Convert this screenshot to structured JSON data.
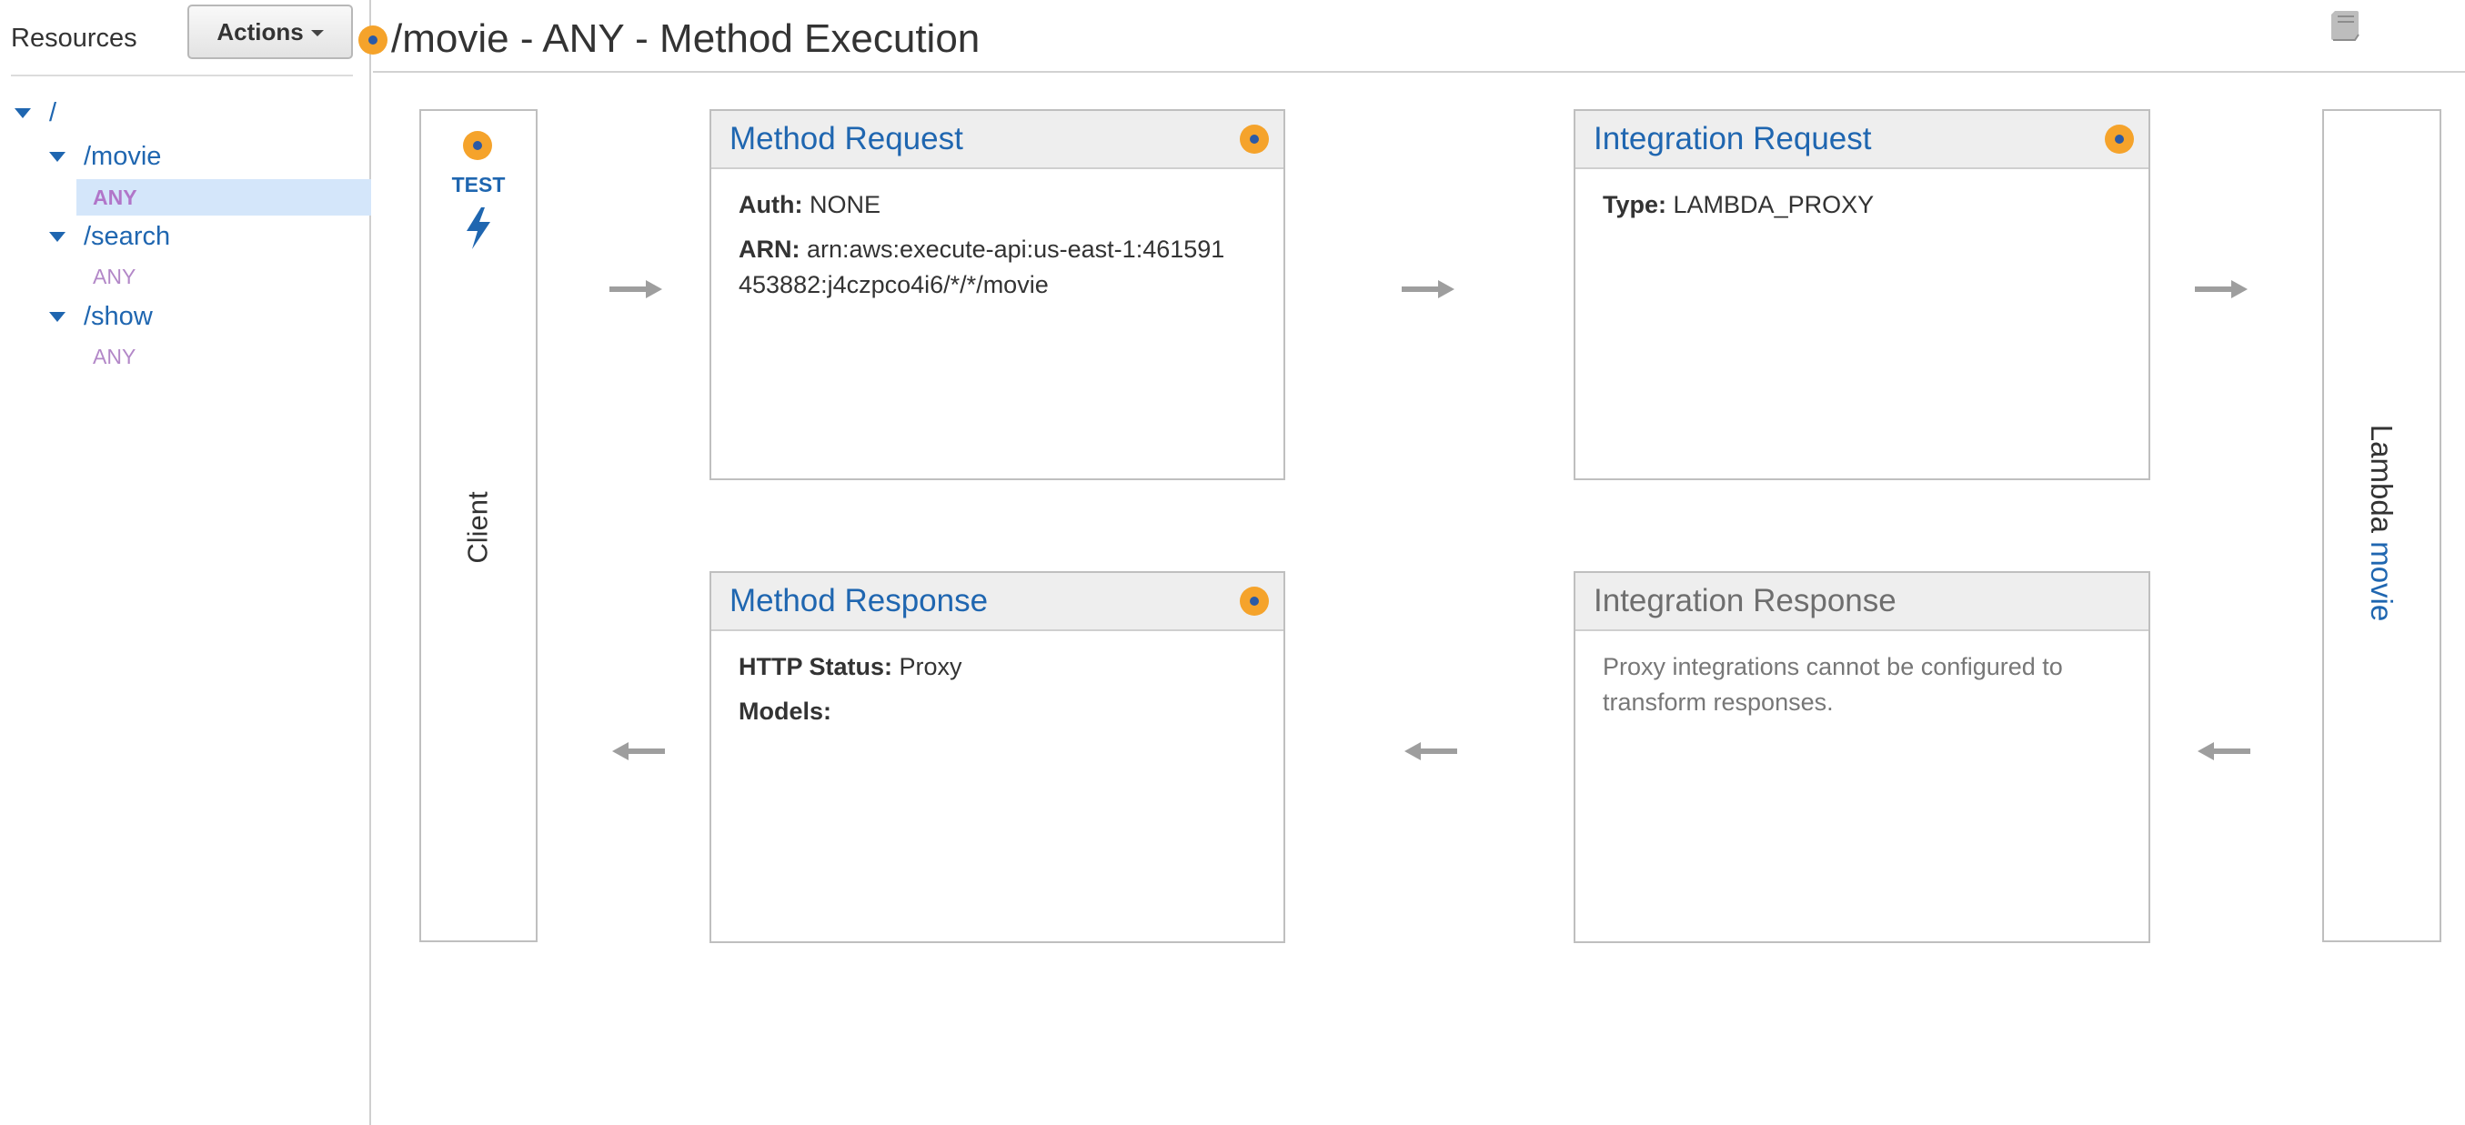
{
  "sidebar": {
    "title": "Resources",
    "actions_label": "Actions",
    "tree": {
      "root": "/",
      "resources": [
        {
          "path": "/movie",
          "method": "ANY"
        },
        {
          "path": "/search",
          "method": "ANY"
        },
        {
          "path": "/show",
          "method": "ANY"
        }
      ]
    }
  },
  "header": {
    "title": "/movie - ANY - Method Execution"
  },
  "client": {
    "test_label": "TEST",
    "label": "Client"
  },
  "method_request": {
    "title": "Method Request",
    "auth_label": "Auth:",
    "auth_value": "NONE",
    "arn_label": "ARN:",
    "arn_value": "arn:aws:execute-api:us-east-1:461591453882:j4czpco4i6/*/*/movie"
  },
  "integration_request": {
    "title": "Integration Request",
    "type_label": "Type:",
    "type_value": "LAMBDA_PROXY"
  },
  "method_response": {
    "title": "Method Response",
    "status_label": "HTTP Status:",
    "status_value": "Proxy",
    "models_label": "Models:"
  },
  "integration_response": {
    "title": "Integration Response",
    "note": "Proxy integrations cannot be configured to transform responses."
  },
  "lambda": {
    "label": "Lambda",
    "function_name": "movie"
  },
  "colors": {
    "link_blue": "#1f66b0",
    "settings_orange": "#f5a32b",
    "method_purple": "#b388c8",
    "selected_bg": "#d4e6fa"
  },
  "icons": [
    "settings-icon",
    "book-icon",
    "lightning-bolt-icon",
    "caret-down-icon",
    "expand-triangle-icon",
    "arrow-right-icon",
    "arrow-left-icon"
  ]
}
